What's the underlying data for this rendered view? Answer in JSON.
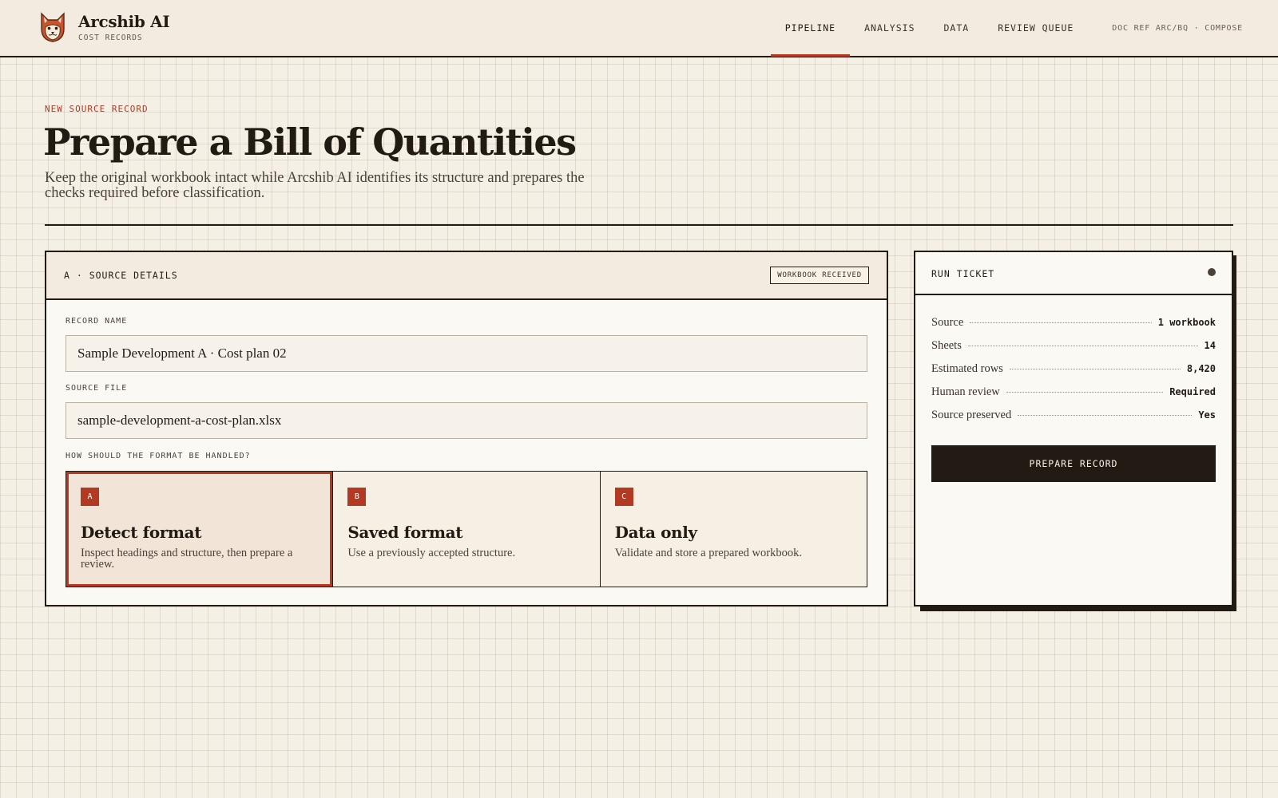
{
  "brand": {
    "name": "Arcshib AI",
    "subtitle": "COST RECORDS",
    "logo_icon": "shiba-dog-logo"
  },
  "nav": {
    "items": [
      {
        "label": "PIPELINE",
        "active": true
      },
      {
        "label": "ANALYSIS",
        "active": false
      },
      {
        "label": "DATA",
        "active": false
      },
      {
        "label": "REVIEW QUEUE",
        "active": false
      }
    ],
    "doc_ref": "DOC REF ARC/BQ · COMPOSE"
  },
  "page": {
    "eyebrow": "NEW SOURCE RECORD",
    "title": "Prepare a Bill of Quantities",
    "description": "Keep the original workbook intact while Arcshib AI identifies its structure and prepares the checks required before classification."
  },
  "source_panel": {
    "title": "A · SOURCE DETAILS",
    "badge": "WORKBOOK RECEIVED",
    "record_name_label": "RECORD NAME",
    "record_name_value": "Sample Development A · Cost plan 02",
    "source_file_label": "SOURCE FILE",
    "source_file_value": "sample-development-a-cost-plan.xlsx",
    "format_question": "HOW SHOULD THE FORMAT BE HANDLED?",
    "options": [
      {
        "letter": "A",
        "title": "Detect format",
        "description": "Inspect headings and structure, then prepare a review.",
        "selected": true
      },
      {
        "letter": "B",
        "title": "Saved format",
        "description": "Use a previously accepted structure.",
        "selected": false
      },
      {
        "letter": "C",
        "title": "Data only",
        "description": "Validate and store a prepared workbook.",
        "selected": false
      }
    ]
  },
  "run_ticket": {
    "title": "RUN TICKET",
    "rows": [
      {
        "key": "Source",
        "value": "1 workbook"
      },
      {
        "key": "Sheets",
        "value": "14"
      },
      {
        "key": "Estimated rows",
        "value": "8,420"
      },
      {
        "key": "Human review",
        "value": "Required"
      },
      {
        "key": "Source preserved",
        "value": "Yes"
      }
    ],
    "cta_label": "PREPARE RECORD"
  },
  "colors": {
    "accent": "#b23a22",
    "ink": "#211b14",
    "paper": "#f5f0e6"
  }
}
